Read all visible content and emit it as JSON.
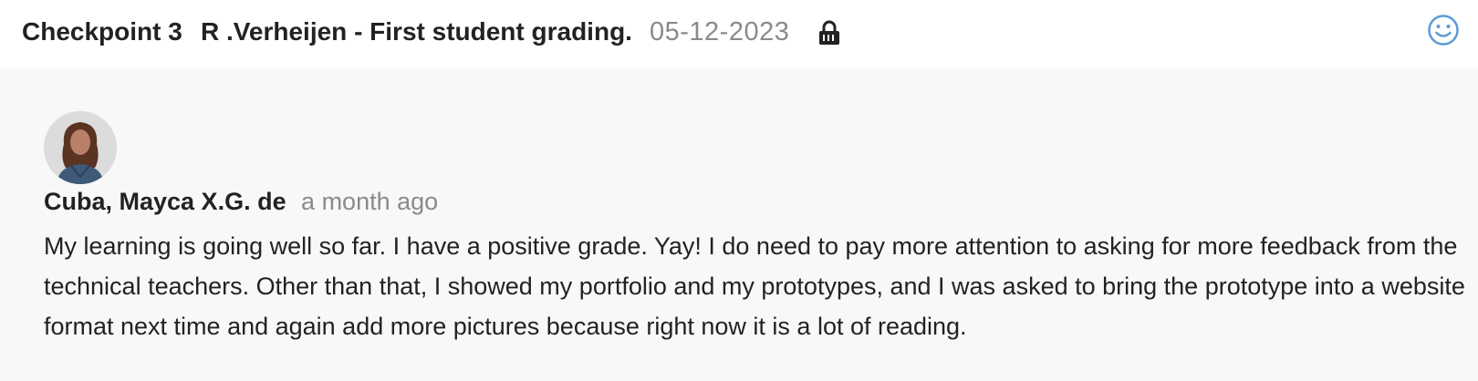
{
  "header": {
    "title": "Checkpoint 3",
    "subtitle": "R .Verheijen - First student grading.",
    "date": "05-12-2023",
    "lock_icon": "lock-icon",
    "reaction_icon": "smiley-icon"
  },
  "comment": {
    "author": "Cuba, Mayca X.G. de",
    "time": "a month ago",
    "body": "My learning is going well so far. I have a positive grade. Yay! I do need to pay more attention to asking for more feedback from the technical teachers. Other than that, I showed my portfolio and my prototypes, and I was asked to bring the prototype into a website format next time and again add more pictures because right now it is a lot of reading."
  },
  "colors": {
    "header_bg": "#ffffff",
    "page_bg": "#f8f8f8",
    "muted_text": "#8a8a8a",
    "accent": "#5b9bd5"
  }
}
